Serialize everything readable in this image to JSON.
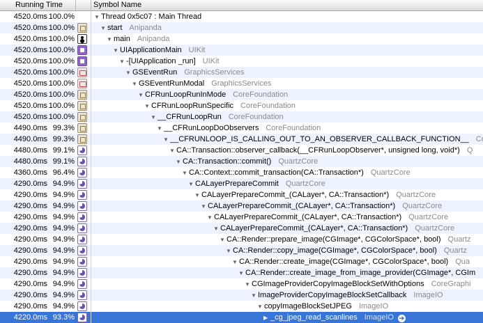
{
  "columns": {
    "running_time": "Running Time",
    "symbol_name": "Symbol Name"
  },
  "rows": [
    {
      "ms": "4520.0ms",
      "pct": "100.0%",
      "icon": "none",
      "depth": 0,
      "symbol": "Thread 0x5c07 : Main Thread",
      "lib": ""
    },
    {
      "ms": "4520.0ms",
      "pct": "100.0%",
      "icon": "can",
      "depth": 1,
      "symbol": "start",
      "lib": "Anipanda"
    },
    {
      "ms": "4520.0ms",
      "pct": "100.0%",
      "icon": "user",
      "depth": 2,
      "symbol": "main",
      "lib": "Anipanda"
    },
    {
      "ms": "4520.0ms",
      "pct": "100.0%",
      "icon": "purple",
      "depth": 3,
      "symbol": "UIApplicationMain",
      "lib": "UIKit"
    },
    {
      "ms": "4520.0ms",
      "pct": "100.0%",
      "icon": "purple",
      "depth": 4,
      "symbol": "-[UIApplication _run]",
      "lib": "UIKit"
    },
    {
      "ms": "4520.0ms",
      "pct": "100.0%",
      "icon": "bag",
      "depth": 5,
      "symbol": "GSEventRun",
      "lib": "GraphicsServices"
    },
    {
      "ms": "4520.0ms",
      "pct": "100.0%",
      "icon": "bag",
      "depth": 6,
      "symbol": "GSEventRunModal",
      "lib": "GraphicsServices"
    },
    {
      "ms": "4520.0ms",
      "pct": "100.0%",
      "icon": "can",
      "depth": 7,
      "symbol": "CFRunLoopRunInMode",
      "lib": "CoreFoundation"
    },
    {
      "ms": "4520.0ms",
      "pct": "100.0%",
      "icon": "can",
      "depth": 8,
      "symbol": "CFRunLoopRunSpecific",
      "lib": "CoreFoundation"
    },
    {
      "ms": "4520.0ms",
      "pct": "100.0%",
      "icon": "can",
      "depth": 9,
      "symbol": "__CFRunLoopRun",
      "lib": "CoreFoundation"
    },
    {
      "ms": "4490.0ms",
      "pct": "99.3%",
      "icon": "can",
      "depth": 10,
      "symbol": "__CFRunLoopDoObservers",
      "lib": "CoreFoundation"
    },
    {
      "ms": "4490.0ms",
      "pct": "99.3%",
      "icon": "can",
      "depth": 11,
      "symbol": "__CFRUNLOOP_IS_CALLING_OUT_TO_AN_OBSERVER_CALLBACK_FUNCTION__",
      "lib": "CoreF"
    },
    {
      "ms": "4480.0ms",
      "pct": "99.1%",
      "icon": "pie",
      "depth": 12,
      "symbol": "CA::Transaction::observer_callback(__CFRunLoopObserver*, unsigned long, void*)",
      "lib": "Q"
    },
    {
      "ms": "4480.0ms",
      "pct": "99.1%",
      "icon": "pie",
      "depth": 13,
      "symbol": "CA::Transaction::commit()",
      "lib": "QuartzCore"
    },
    {
      "ms": "4360.0ms",
      "pct": "96.4%",
      "icon": "pie",
      "depth": 14,
      "symbol": "CA::Context::commit_transaction(CA::Transaction*)",
      "lib": "QuartzCore"
    },
    {
      "ms": "4290.0ms",
      "pct": "94.9%",
      "icon": "pie",
      "depth": 15,
      "symbol": "CALayerPrepareCommit",
      "lib": "QuartzCore"
    },
    {
      "ms": "4290.0ms",
      "pct": "94.9%",
      "icon": "pie",
      "depth": 16,
      "symbol": "CALayerPrepareCommit_(CALayer*, CA::Transaction*)",
      "lib": "QuartzCore"
    },
    {
      "ms": "4290.0ms",
      "pct": "94.9%",
      "icon": "pie",
      "depth": 17,
      "symbol": "CALayerPrepareCommit_(CALayer*, CA::Transaction*)",
      "lib": "QuartzCore"
    },
    {
      "ms": "4290.0ms",
      "pct": "94.9%",
      "icon": "pie",
      "depth": 18,
      "symbol": "CALayerPrepareCommit_(CALayer*, CA::Transaction*)",
      "lib": "QuartzCore"
    },
    {
      "ms": "4290.0ms",
      "pct": "94.9%",
      "icon": "pie",
      "depth": 19,
      "symbol": "CALayerPrepareCommit_(CALayer*, CA::Transaction*)",
      "lib": "QuartzCore"
    },
    {
      "ms": "4290.0ms",
      "pct": "94.9%",
      "icon": "pie",
      "depth": 20,
      "symbol": "CA::Render::prepare_image(CGImage*, CGColorSpace*, bool)",
      "lib": "Quartz"
    },
    {
      "ms": "4290.0ms",
      "pct": "94.9%",
      "icon": "pie",
      "depth": 21,
      "symbol": "CA::Render::copy_image(CGImage*, CGColorSpace*, bool)",
      "lib": "Quartz"
    },
    {
      "ms": "4290.0ms",
      "pct": "94.9%",
      "icon": "pie",
      "depth": 22,
      "symbol": "CA::Render::create_image(CGImage*, CGColorSpace*, bool)",
      "lib": "Qua"
    },
    {
      "ms": "4290.0ms",
      "pct": "94.9%",
      "icon": "pie",
      "depth": 23,
      "symbol": "CA::Render::create_image_from_image_provider(CGImage*, CGIm",
      "lib": ""
    },
    {
      "ms": "4290.0ms",
      "pct": "94.9%",
      "icon": "pie",
      "depth": 24,
      "symbol": "CGImageProviderCopyImageBlockSetWithOptions",
      "lib": "CoreGraphi"
    },
    {
      "ms": "4290.0ms",
      "pct": "94.9%",
      "icon": "pie",
      "depth": 25,
      "symbol": "ImageProviderCopyImageBlockSetCallback",
      "lib": "ImageIO"
    },
    {
      "ms": "4290.0ms",
      "pct": "94.9%",
      "icon": "pie",
      "depth": 26,
      "symbol": "copyImageBlockSetJPEG",
      "lib": "ImageIO"
    },
    {
      "ms": "4220.0ms",
      "pct": "93.3%",
      "icon": "pie",
      "depth": 27,
      "symbol": "_cg_jpeg_read_scanlines",
      "lib": "ImageIO",
      "selected": true,
      "expander": "▶",
      "go": "➔"
    }
  ],
  "expander_open": "▼",
  "colors": {
    "selection": "#3875d7",
    "alt_row": "#edf3fe",
    "library_text": "#8a8a8a"
  }
}
